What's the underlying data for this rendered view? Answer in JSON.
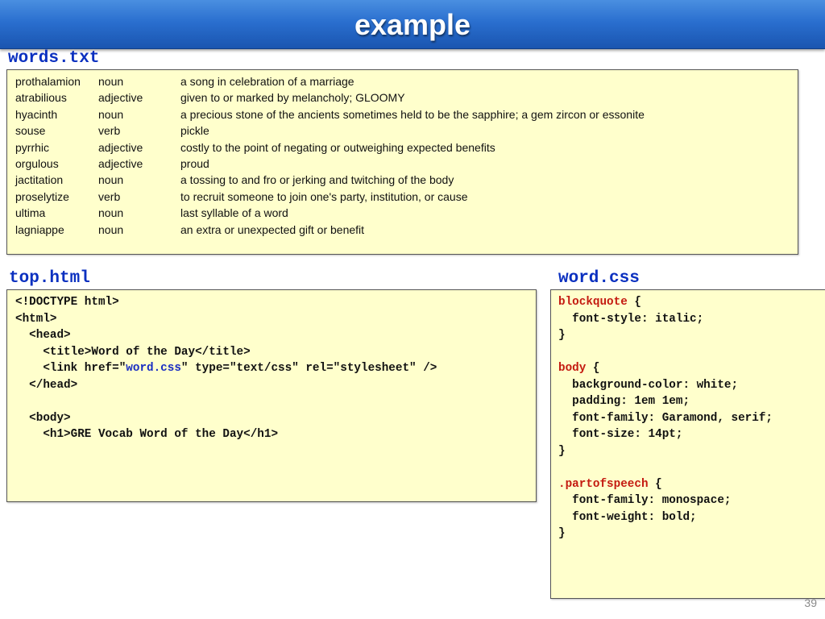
{
  "title": "example",
  "page_number": "39",
  "words_file": {
    "label": "words.txt",
    "rows": [
      {
        "word": "prothalamion",
        "pos": "noun",
        "definition": "a song in celebration of a marriage"
      },
      {
        "word": "atrabilious",
        "pos": "adjective",
        "definition": "given to or marked by melancholy; GLOOMY"
      },
      {
        "word": "hyacinth",
        "pos": "noun",
        "definition": "a precious stone of the ancients sometimes held to be the sapphire; a gem zircon or essonite"
      },
      {
        "word": "souse",
        "pos": "verb",
        "definition": "pickle"
      },
      {
        "word": "pyrrhic",
        "pos": "adjective",
        "definition": "costly to the point of negating or outweighing expected benefits"
      },
      {
        "word": "orgulous",
        "pos": "adjective",
        "definition": "proud"
      },
      {
        "word": "jactitation",
        "pos": "noun",
        "definition": "a tossing to and fro or jerking and twitching of the body"
      },
      {
        "word": "proselytize",
        "pos": "verb",
        "definition": "to recruit someone to join one's party, institution, or cause"
      },
      {
        "word": "ultima",
        "pos": "noun",
        "definition": "last syllable of a word"
      },
      {
        "word": "lagniappe",
        "pos": "noun",
        "definition": "an extra or unexpected gift or benefit"
      }
    ]
  },
  "top_html": {
    "label": "top.html",
    "lines": {
      "doctype": "<!DOCTYPE html>",
      "html_open": "<html>",
      "head_open": "  <head>",
      "title_line": "    <title>Word of the Day</title>",
      "link_before": "    <link href=\"",
      "link_href": "word.css",
      "link_after": "\" type=\"text/css\" rel=\"stylesheet\" />",
      "head_close": "  </head>",
      "blank": "",
      "body_open": "  <body>",
      "h1_line": "    <h1>GRE Vocab Word of the Day</h1>"
    }
  },
  "word_css": {
    "label": "word.css",
    "rules": [
      {
        "selector": "blockquote",
        "declarations": [
          "font-style: italic;"
        ]
      },
      {
        "selector": "body",
        "declarations": [
          "background-color: white;",
          "padding: 1em 1em;",
          "font-family: Garamond, serif;",
          "font-size: 14pt;"
        ]
      },
      {
        "selector": ".partofspeech",
        "declarations": [
          "font-family: monospace;",
          "font-weight: bold;"
        ]
      }
    ]
  },
  "colors": {
    "title_bar": "#2a6fcf",
    "section_label": "#0b30c0",
    "box_background": "#ffffcc",
    "css_selector": "#c41a10",
    "link_highlight": "#1a2ec2"
  }
}
